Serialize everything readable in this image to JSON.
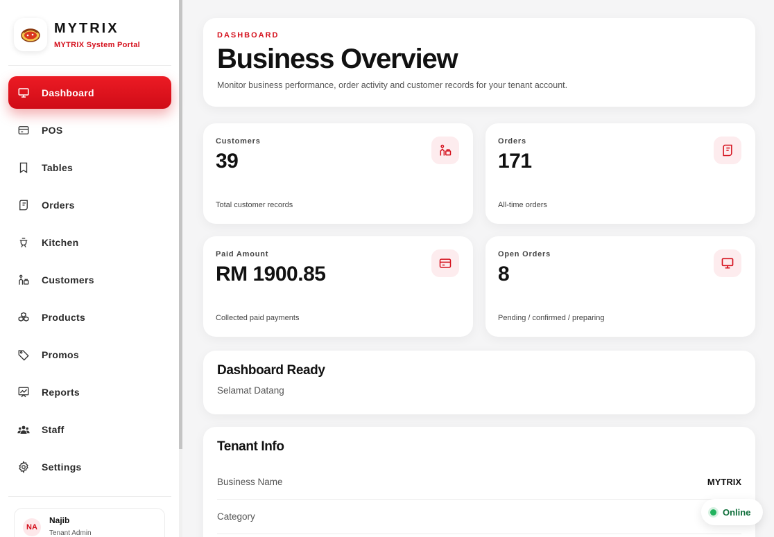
{
  "brand": {
    "name": "MYTRIX",
    "subtitle": "MYTRIX System Portal"
  },
  "nav": [
    {
      "label": "Dashboard",
      "icon": "monitor-icon",
      "active": true
    },
    {
      "label": "POS",
      "icon": "card-icon"
    },
    {
      "label": "Tables",
      "icon": "bookmark-icon"
    },
    {
      "label": "Orders",
      "icon": "receipt-icon"
    },
    {
      "label": "Kitchen",
      "icon": "cooking-pot-icon"
    },
    {
      "label": "Customers",
      "icon": "customer-icon"
    },
    {
      "label": "Products",
      "icon": "boxes-icon"
    },
    {
      "label": "Promos",
      "icon": "tag-icon"
    },
    {
      "label": "Reports",
      "icon": "chart-board-icon"
    },
    {
      "label": "Staff",
      "icon": "users-icon"
    },
    {
      "label": "Settings",
      "icon": "gear-icon"
    }
  ],
  "user": {
    "initials": "NA",
    "name": "Najib",
    "role": "Tenant Admin"
  },
  "header": {
    "eyebrow": "DASHBOARD",
    "title": "Business Overview",
    "description": "Monitor business performance, order activity and customer records for your tenant account."
  },
  "stats": [
    {
      "label": "Customers",
      "value": "39",
      "caption": "Total customer records",
      "icon": "customer-icon"
    },
    {
      "label": "Orders",
      "value": "171",
      "caption": "All-time orders",
      "icon": "receipt-icon"
    },
    {
      "label": "Paid Amount",
      "value": "RM 1900.85",
      "caption": "Collected paid payments",
      "icon": "card-icon"
    },
    {
      "label": "Open Orders",
      "value": "8",
      "caption": "Pending / confirmed / preparing",
      "icon": "monitor-icon"
    }
  ],
  "ready": {
    "title": "Dashboard Ready",
    "subtitle": "Selamat Datang"
  },
  "tenant": {
    "title": "Tenant Info",
    "rows": [
      {
        "key": "Business Name",
        "value": "MYTRIX"
      },
      {
        "key": "Category",
        "value": ""
      }
    ]
  },
  "status": {
    "label": "Online",
    "color": "#22b35e"
  },
  "colors": {
    "accent": "#d40f1b",
    "accent_soft": "#fdecee"
  }
}
